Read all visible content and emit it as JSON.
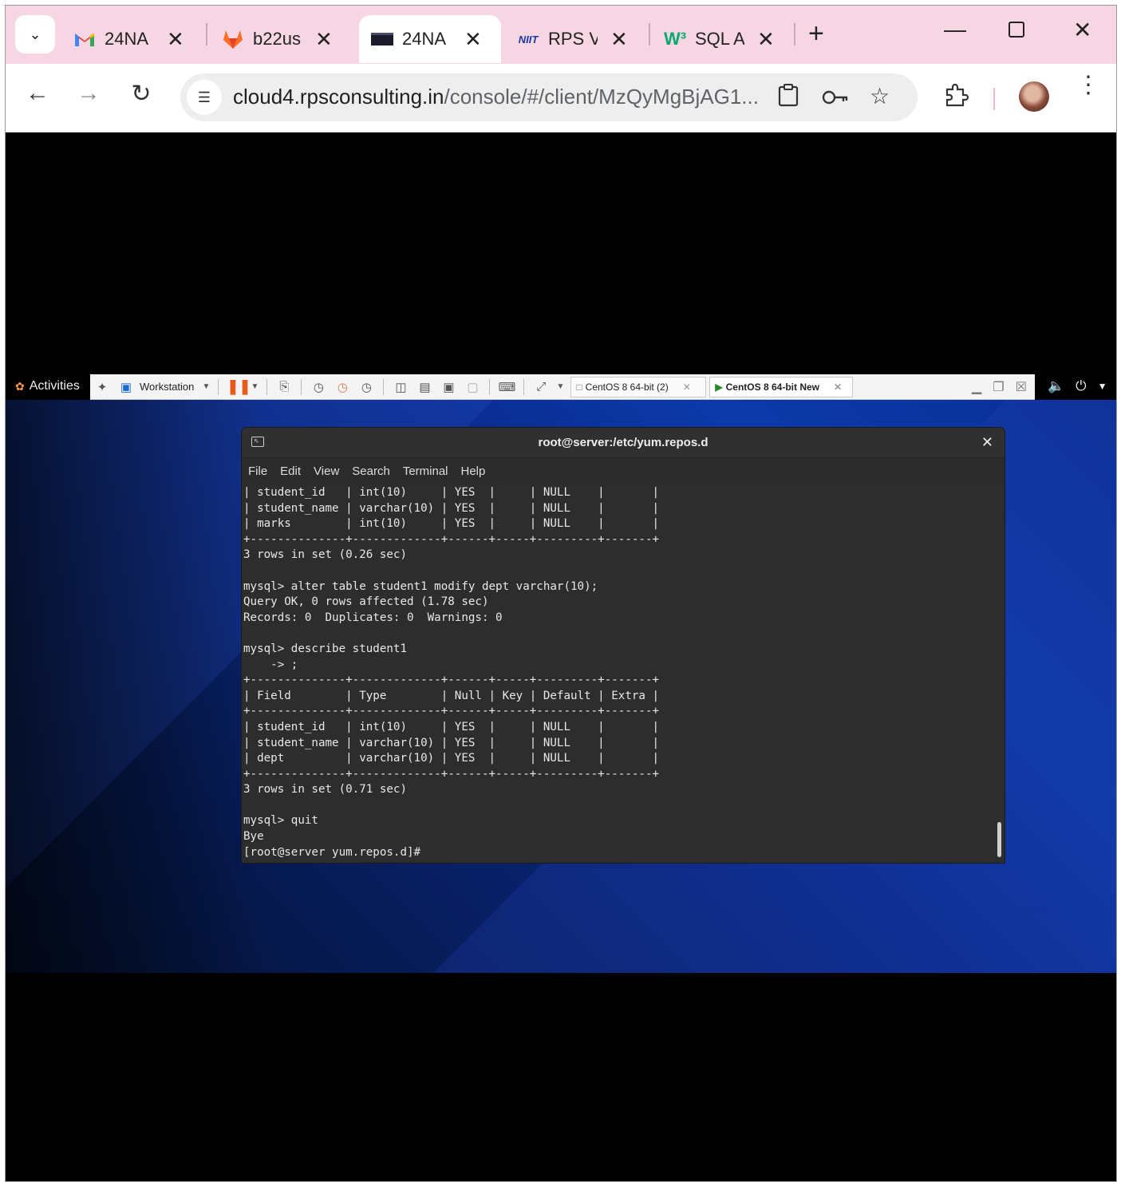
{
  "browser": {
    "tabs": [
      {
        "favicon": "gmail-icon",
        "title": "24NA",
        "active": false
      },
      {
        "favicon": "gitlab-icon",
        "title": "b22us",
        "active": false
      },
      {
        "favicon": "console-icon",
        "title": "24NA",
        "active": true
      },
      {
        "favicon": "niit-icon",
        "title": "RPS V",
        "active": false
      },
      {
        "favicon": "w3schools-icon",
        "title": "SQL A",
        "active": false
      }
    ],
    "tab_favicon_text": {
      "niit": "NIIT",
      "w3": "W³"
    },
    "address": {
      "host": "cloud4.rpsconsulting.in",
      "path": "/console/#/client/MzQyMgBjAG1..."
    }
  },
  "gnome": {
    "activities_label": "Activities"
  },
  "vmware": {
    "workstation_label": "Workstation",
    "vm_tabs": [
      {
        "label": "CentOS 8 64-bit (2)",
        "active": false
      },
      {
        "label": "CentOS 8 64-bit New",
        "active": true
      }
    ]
  },
  "terminal": {
    "title": "root@server:/etc/yum.repos.d",
    "menu": [
      "File",
      "Edit",
      "View",
      "Search",
      "Terminal",
      "Help"
    ],
    "lines": [
      "| student_id   | int(10)     | YES  |     | NULL    |       |",
      "| student_name | varchar(10) | YES  |     | NULL    |       |",
      "| marks        | int(10)     | YES  |     | NULL    |       |",
      "+--------------+-------------+------+-----+---------+-------+",
      "3 rows in set (0.26 sec)",
      "",
      "mysql> alter table student1 modify dept varchar(10);",
      "Query OK, 0 rows affected (1.78 sec)",
      "Records: 0  Duplicates: 0  Warnings: 0",
      "",
      "mysql> describe student1",
      "    -> ;",
      "+--------------+-------------+------+-----+---------+-------+",
      "| Field        | Type        | Null | Key | Default | Extra |",
      "+--------------+-------------+------+-----+---------+-------+",
      "| student_id   | int(10)     | YES  |     | NULL    |       |",
      "| student_name | varchar(10) | YES  |     | NULL    |       |",
      "| dept         | varchar(10) | YES  |     | NULL    |       |",
      "+--------------+-------------+------+-----+---------+-------+",
      "3 rows in set (0.71 sec)",
      "",
      "mysql> quit",
      "Bye",
      "[root@server yum.repos.d]#"
    ]
  }
}
